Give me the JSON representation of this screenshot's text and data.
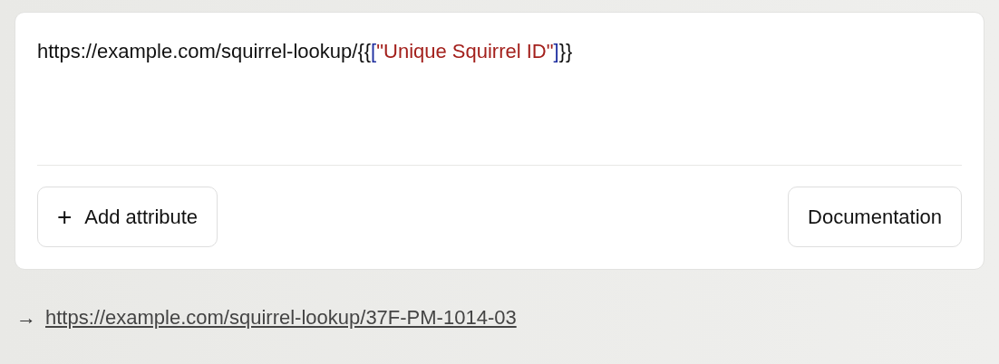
{
  "editor": {
    "tokens": [
      {
        "kind": "plain",
        "text": "https://example.com/squirrel-lookup/{{"
      },
      {
        "kind": "bracket",
        "text": "["
      },
      {
        "kind": "string",
        "text": "\"Unique Squirrel ID\""
      },
      {
        "kind": "bracket",
        "text": "]"
      },
      {
        "kind": "plain",
        "text": "}}"
      }
    ]
  },
  "buttons": {
    "add": {
      "icon": "+",
      "label": "Add attribute"
    },
    "docs": {
      "label": "Documentation"
    }
  },
  "preview": {
    "arrow": "→",
    "url": "https://example.com/squirrel-lookup/37F-PM-1014-03"
  }
}
